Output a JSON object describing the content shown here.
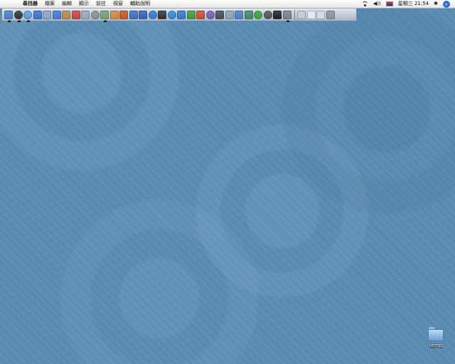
{
  "menubar": {
    "menus": [
      "尋找器",
      "檔案",
      "編輯",
      "顯示",
      "前往",
      "視窗",
      "輔助說明"
    ],
    "status": {
      "clock": "星期三 21:54",
      "volume_glyph": "◀))",
      "bluetooth_glyph": "✱",
      "spotlight_glyph": "⌕"
    }
  },
  "dock": {
    "apps": [
      {
        "name": "finder-icon",
        "color": "#4a7fc9",
        "running": true
      },
      {
        "name": "dashboard-icon",
        "color": "#333333",
        "running": true,
        "round": true
      },
      {
        "name": "safari-icon",
        "color": "#5aa0e0",
        "running": true,
        "round": true
      },
      {
        "name": "ichat-icon",
        "color": "#3b6fd4"
      },
      {
        "name": "mail-icon",
        "color": "#8aa5c8"
      },
      {
        "name": "itunes-icon",
        "color": "#3f7ad6"
      },
      {
        "name": "address-book-icon",
        "color": "#b88a4a"
      },
      {
        "name": "ical-icon",
        "color": "#d04040"
      },
      {
        "name": "preview-icon",
        "color": "#9aa7b5"
      },
      {
        "name": "system-prefs-icon",
        "color": "#8a8f99",
        "round": true
      },
      {
        "name": "iphoto-icon",
        "color": "#6fa36f",
        "running": true
      },
      {
        "name": "garageband-icon",
        "color": "#d08a3a"
      },
      {
        "name": "photoshop-icon",
        "color": "#c8551e"
      },
      {
        "name": "iweb-icon",
        "color": "#3a6ec4"
      },
      {
        "name": "idvd-icon",
        "color": "#2f62b8"
      },
      {
        "name": "firefox-icon",
        "color": "#2e7bd6",
        "round": true
      },
      {
        "name": "terminal-icon",
        "color": "#303030"
      },
      {
        "name": "quicktime-icon",
        "color": "#2a8ad8",
        "round": true
      },
      {
        "name": "word-icon",
        "color": "#2d78d4"
      },
      {
        "name": "dreamweaver-icon",
        "color": "#3d9a3d"
      },
      {
        "name": "flash-icon",
        "color": "#d04a2a"
      },
      {
        "name": "media-player-icon",
        "color": "#7a5ab5",
        "round": true
      },
      {
        "name": "console-icon",
        "color": "#404a55"
      },
      {
        "name": "activity-monitor-icon",
        "color": "#8aa5b8"
      },
      {
        "name": "keynote-icon",
        "color": "#4a7fc9"
      },
      {
        "name": "utility-icon",
        "color": "#3a8a6a"
      },
      {
        "name": "skype-icon",
        "color": "#3aa53a",
        "round": true
      },
      {
        "name": "disk-utility-icon",
        "color": "#555555",
        "round": true
      },
      {
        "name": "monitor-icon",
        "color": "#202020"
      },
      {
        "name": "automator-icon",
        "color": "#7a7f88",
        "running": true
      }
    ],
    "others": [
      {
        "name": "downloads-icon",
        "color": "#c5ccd6"
      },
      {
        "name": "documents-stack-icon",
        "color": "#e8ecf0"
      },
      {
        "name": "pictures-stack-icon",
        "color": "#d7dde4"
      },
      {
        "name": "trash-icon",
        "color": "#8b949e"
      }
    ]
  },
  "desktop": {
    "folder_label": "temp"
  }
}
